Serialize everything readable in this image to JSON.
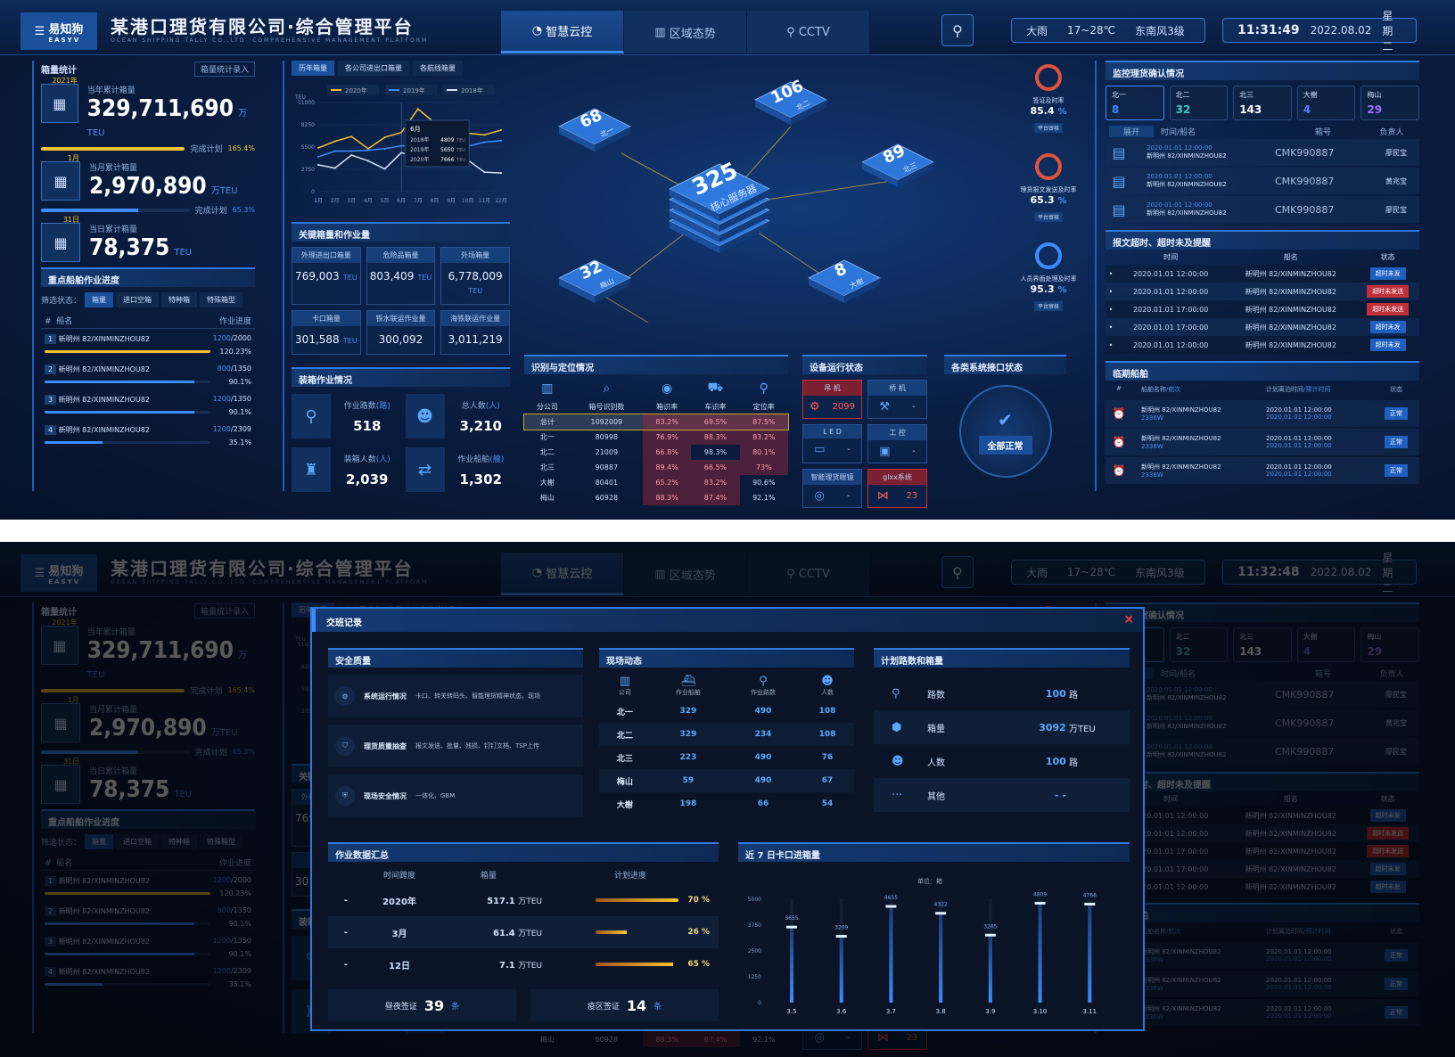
{
  "header": {
    "logo_cn": "易知狗",
    "logo_en": "EASYV",
    "title": "某港口理货有限公司·综合管理平台",
    "subtitle": "OCEAN SHIPPING TALLY CO.,LTD ·COMPREHENSIVE MANAGEMENT PLATFORM",
    "tabs": [
      {
        "label": "智慧云控",
        "icon": "gauge-icon"
      },
      {
        "label": "区域态势",
        "icon": "building-icon"
      },
      {
        "label": "CCTV",
        "icon": "camera-icon"
      }
    ],
    "weather": {
      "condition": "大雨",
      "temp": "17~28℃",
      "wind": "东南风3级"
    },
    "time": "11:31:49",
    "date": "2022.08.02",
    "weekday": "星期二"
  },
  "background": {
    "time": "11:32:48"
  },
  "left": {
    "title": "箱量统计",
    "entry_button": "箱量统计录入",
    "stats": [
      {
        "tag": "2021年",
        "label": "当年累计箱量",
        "value": "329,711,690",
        "unit": "万TEU",
        "plan_label": "完成计划",
        "plan": "165.4%",
        "progress": 100,
        "color": "#f2c230"
      },
      {
        "tag": "1月",
        "label": "当月累计箱量",
        "value": "2,970,890",
        "unit": "万TEU",
        "plan_label": "完成计划",
        "plan": "65.3%",
        "progress": 65.3,
        "color": "#3c8cff"
      },
      {
        "tag": "31日",
        "label": "当日累计箱量",
        "value": "78,375",
        "unit": "TEU"
      }
    ],
    "ships": {
      "title": "重点船舶作业进度",
      "filter_label": "筛选状态：",
      "filters": [
        "箱量",
        "进口空箱",
        "特种箱",
        "特殊箱型"
      ],
      "col_no": "#",
      "col_name": "船名",
      "col_progress": "作业进度",
      "rows": [
        {
          "no": "1",
          "name": "新明州 82/XINMINZHOU82",
          "done": "1200",
          "total": "/2000",
          "pct": "120.23%",
          "progress": 100,
          "color": "#f2c230"
        },
        {
          "no": "2",
          "name": "新明州 82/XINMINZHOU82",
          "done": "800",
          "total": "/1350",
          "pct": "90.1%",
          "progress": 90.1,
          "color": "#3c8cff"
        },
        {
          "no": "3",
          "name": "新明州 82/XINMINZHOU82",
          "done": "1200",
          "total": "/1350",
          "pct": "90.1%",
          "progress": 90.1,
          "color": "#3c8cff"
        },
        {
          "no": "4",
          "name": "新明州 82/XINMINZHOU82",
          "done": "1200",
          "total": "/2309",
          "pct": "35.1%",
          "progress": 35.1,
          "color": "#3c8cff"
        }
      ]
    }
  },
  "col2": {
    "tabs": [
      "历年箱量",
      "各公司进出口箱量",
      "各航线箱量"
    ],
    "key": {
      "title": "关键箱量和作业量",
      "cards": [
        {
          "label": "外理进出口箱量",
          "value": "769,003",
          "unit": "TEU"
        },
        {
          "label": "危险品箱量",
          "value": "803,409",
          "unit": "TEU"
        },
        {
          "label": "外场箱量",
          "value": "6,778,009",
          "unit": "TEU"
        },
        {
          "label": "卡口箱量",
          "value": "301,588",
          "unit": "TEU"
        },
        {
          "label": "铁水联运作业量",
          "value": "300,092",
          "unit": ""
        },
        {
          "label": "海铁联运作业量",
          "value": "3,011,219",
          "unit": ""
        }
      ]
    },
    "work": {
      "title": "装箱作业情况",
      "items": [
        {
          "label": "作业路数",
          "unit": "(路)",
          "value": "518",
          "icon": "route-icon"
        },
        {
          "label": "总人数",
          "unit": "(人)",
          "value": "3,210",
          "icon": "people-icon"
        },
        {
          "label": "装箱人数",
          "unit": "(人)",
          "value": "2,039",
          "icon": "worker-icon"
        },
        {
          "label": "作业船舶",
          "unit": "(艘)",
          "value": "1,302",
          "icon": "transfer-icon"
        }
      ]
    }
  },
  "center": {
    "nodes": [
      {
        "value": "325",
        "label": "核心服务器"
      },
      {
        "value": "68",
        "label": "北一"
      },
      {
        "value": "106",
        "label": "北二"
      },
      {
        "value": "89",
        "label": "北三"
      },
      {
        "value": "32",
        "label": "梅山"
      },
      {
        "value": "8",
        "label": "大榭"
      }
    ],
    "gauges": [
      {
        "label": "签证及时率",
        "value": "85.4",
        "unit": "%",
        "button": "平台审核",
        "color": "#e0533a"
      },
      {
        "label": "理货报文发送及时率",
        "value": "65.3",
        "unit": "%",
        "button": "平台审核",
        "color": "#e0533a"
      },
      {
        "label": "人员界面处理及时率",
        "value": "95.3",
        "unit": "%",
        "button": "平台审核",
        "color": "#3c8cff"
      }
    ],
    "recog": {
      "title": "识别与定位情况",
      "headers": [
        "分公司",
        "箱号识别数",
        "箱识率",
        "车识率",
        "定位率"
      ],
      "rows": [
        [
          "总计",
          "1092009",
          "83.2%",
          "69.5%",
          "87.5%"
        ],
        [
          "北一",
          "80998",
          "76.9%",
          "88.3%",
          "83.2%"
        ],
        [
          "北二",
          "21009",
          "66.8%",
          "98.3%",
          "80.1%"
        ],
        [
          "北三",
          "90887",
          "89.4%",
          "66.5%",
          "73%"
        ],
        [
          "大榭",
          "80401",
          "65.2%",
          "83.2%",
          "90.6%"
        ],
        [
          "梅山",
          "60928",
          "88.3%",
          "87.4%",
          "92.1%"
        ]
      ]
    },
    "devices": {
      "title": "设备运行状态",
      "items": [
        {
          "label": "吊 机",
          "value": "2099",
          "alert": true,
          "icon": "crane-icon"
        },
        {
          "label": "桥 机",
          "value": "-",
          "alert": false,
          "icon": "bridge-crane-icon"
        },
        {
          "label": "L E D",
          "value": "-",
          "alert": false,
          "icon": "led-icon"
        },
        {
          "label": "工 控",
          "value": "-",
          "alert": false,
          "icon": "lock-icon"
        },
        {
          "label": "智能理货眼镜",
          "value": "-",
          "alert": false,
          "icon": "glasses-icon"
        },
        {
          "label": "glxx系统",
          "value": "23",
          "alert": true,
          "icon": "share-icon"
        }
      ]
    },
    "interfaces": {
      "title": "各类系统接口状态",
      "status": "全部正常"
    }
  },
  "right": {
    "monitor": {
      "title": "监控理货确认情况",
      "tabs": [
        {
          "label": "北一",
          "value": "8",
          "color": "#3c8cff"
        },
        {
          "label": "北二",
          "value": "32",
          "color": "#3cc8c8"
        },
        {
          "label": "北三",
          "value": "143",
          "color": "#ffffff"
        },
        {
          "label": "大榭",
          "value": "4",
          "color": "#5a7bff"
        },
        {
          "label": "梅山",
          "value": "29",
          "color": "#a070ff"
        }
      ],
      "toggle": "展开",
      "col_time": "时间/船名",
      "col_box": "箱号",
      "col_person": "负责人",
      "rows": [
        {
          "time": "2020.01.01 12:00:00",
          "ship": "新明州 82/XINMINZHOU82",
          "box": "CMK990887",
          "person": "廖民宝"
        },
        {
          "time": "2020.01.01 12:00:00",
          "ship": "新明州 82/XINMINZHOU82",
          "box": "CMK990887",
          "person": "黄兆宝"
        },
        {
          "time": "2020.01.01 12:00:00",
          "ship": "新明州 82/XINMINZHOU82",
          "box": "CMK990887",
          "person": "廖民宝"
        }
      ]
    },
    "overtime": {
      "title": "报文超时、超时未及提醒",
      "col_time": "时间",
      "col_ship": "船名",
      "col_status": "状态",
      "rows": [
        {
          "time": "2020.01.01 12:00:00",
          "ship": "新明州 82/XINMINZHOU82",
          "status": "超时未发",
          "color": "#1f5fc0"
        },
        {
          "time": "2020.01.01 12:00:00",
          "ship": "新明州 82/XINMINZHOU82",
          "status": "超时未发送",
          "color": "#c0303a"
        },
        {
          "time": "2020.01.01 17:00:00",
          "ship": "新明州 82/XINMINZHOU82",
          "status": "超时未发送",
          "color": "#c0303a"
        },
        {
          "time": "2020.01.01 17:00:00",
          "ship": "新明州 82/XINMINZHOU82",
          "status": "超时未发",
          "color": "#1f5fc0"
        },
        {
          "time": "2020.01.01 12:00:00",
          "ship": "新明州 82/XINMINZHOU82",
          "status": "超时未发",
          "color": "#1f5fc0"
        }
      ]
    },
    "due": {
      "title": "临期船舶",
      "col_no": "#",
      "col_name": "船舶名称",
      "col_voyage": "/航次",
      "col_plan": "计划离泊时间",
      "col_eta": "/预计时间",
      "col_status": "状态",
      "rows": [
        {
          "ship": "新明州 82/XINMINZHOU82",
          "voyage": "2336W",
          "plan": "2020.01.01 12:00:00",
          "eta": "2020.01.01 12:00:00",
          "status": "正常"
        },
        {
          "ship": "新明州 82/XINMINZHOU82",
          "voyage": "2336W",
          "plan": "2020.01.01 12:00:00",
          "eta": "2020.01.01 12:00:00",
          "status": "正常"
        },
        {
          "ship": "新明州 82/XINMINZHOU82",
          "voyage": "2336W",
          "plan": "2020.01.01 12:00:00",
          "eta": "2020.01.01 12:00:00",
          "status": "正常"
        }
      ]
    }
  },
  "modal": {
    "title": "交班记录",
    "close": "×",
    "safety": {
      "title": "安全质量",
      "items": [
        {
          "label": "系统运行情况",
          "desc": "卡口、转关转码头、智能理货精神状态、现场",
          "icon": "gear-icon"
        },
        {
          "label": "理货质量抽查",
          "desc": "报文发送、批量、残损、钉钉文档、TSP上传",
          "icon": "shield-search-icon"
        },
        {
          "label": "现场安全情况",
          "desc": "一体化、GBM",
          "icon": "shield-icon"
        }
      ]
    },
    "site": {
      "title": "现场动态",
      "headers": [
        {
          "label": "公司",
          "icon": "building-icon"
        },
        {
          "label": "作业船舶",
          "icon": "ship-icon"
        },
        {
          "label": "作业路数",
          "icon": "route-icon"
        },
        {
          "label": "人数",
          "icon": "people-icon"
        }
      ],
      "rows": [
        [
          "北一",
          "329",
          "490",
          "108"
        ],
        [
          "北二",
          "329",
          "234",
          "108"
        ],
        [
          "北三",
          "223",
          "490",
          "76"
        ],
        [
          "梅山",
          "59",
          "490",
          "67"
        ],
        [
          "大榭",
          "198",
          "66",
          "54"
        ]
      ]
    },
    "plan": {
      "title": "计划路数和箱量",
      "items": [
        {
          "label": "路数",
          "value": "100",
          "unit": "路",
          "icon": "route-icon"
        },
        {
          "label": "箱量",
          "value": "3092",
          "unit": "万TEU",
          "icon": "box-icon"
        },
        {
          "label": "人数",
          "value": "100",
          "unit": "路",
          "icon": "people-icon"
        },
        {
          "label": "其他",
          "value": "- -",
          "unit": "",
          "icon": "more-icon"
        }
      ]
    },
    "summary": {
      "title": "作业数据汇总",
      "col_span": "时间跨度",
      "col_volume": "箱量",
      "col_progress": "计划进度",
      "rows": [
        {
          "span": "2020年",
          "value": "517.1",
          "unit": "万TEU",
          "pct": 70,
          "pct_label": "70 %"
        },
        {
          "span": "3月",
          "value": "61.4",
          "unit": "万TEU",
          "pct": 26,
          "pct_label": "26 %"
        },
        {
          "span": "12日",
          "value": "7.1",
          "unit": "万TEU",
          "pct": 65,
          "pct_label": "65 %"
        }
      ],
      "visa": [
        {
          "label": "昼夜签证",
          "value": "39",
          "unit": "条"
        },
        {
          "label": "疫区签证",
          "value": "14",
          "unit": "条"
        }
      ]
    }
  },
  "chart_data": [
    {
      "type": "line",
      "x": [
        "1月",
        "2月",
        "3月",
        "4月",
        "5月",
        "6月",
        "7月",
        "8月",
        "9月",
        "10月",
        "11月",
        "12月"
      ],
      "ylabel": "TEU",
      "ylim": [
        0,
        11000
      ],
      "yticks": [
        0,
        2750,
        5500,
        8250,
        11000
      ],
      "grid": true,
      "legend": "top",
      "series": [
        {
          "name": "2020年",
          "color": "#f2c230",
          "values": [
            5400,
            6200,
            6800,
            5300,
            6700,
            7300,
            10200,
            8500,
            8000,
            7200,
            7000,
            7600
          ]
        },
        {
          "name": "2019年",
          "color": "#3c8cff",
          "values": [
            4300,
            5000,
            5000,
            5100,
            5300,
            5650,
            5700,
            5800,
            5900,
            5600,
            6100,
            6300
          ]
        },
        {
          "name": "2018年",
          "color": "#d8e2f2",
          "values": [
            3300,
            2900,
            4500,
            3800,
            2800,
            4809,
            4200,
            4000,
            3800,
            3900,
            2400,
            2300
          ]
        }
      ],
      "tooltip": {
        "title": "6月",
        "items": [
          {
            "name": "2018年",
            "value": "4809",
            "unit": "TEU"
          },
          {
            "name": "2019年",
            "value": "5650",
            "unit": "TEU"
          },
          {
            "name": "2020年",
            "value": "7666",
            "unit": "TEU"
          }
        ]
      }
    },
    {
      "type": "bar",
      "title": "近 7 日卡口进箱量",
      "unit_label": "单位：箱",
      "categories": [
        "3.5",
        "3.6",
        "3.7",
        "3.8",
        "3.9",
        "3.10",
        "3.11"
      ],
      "values": [
        3655,
        3209,
        4655,
        4322,
        3265,
        4809,
        4766
      ],
      "ylim": [
        0,
        5000
      ],
      "yticks": [
        0,
        1250,
        2500,
        3750,
        5000
      ],
      "color": "#3c8cff"
    }
  ]
}
